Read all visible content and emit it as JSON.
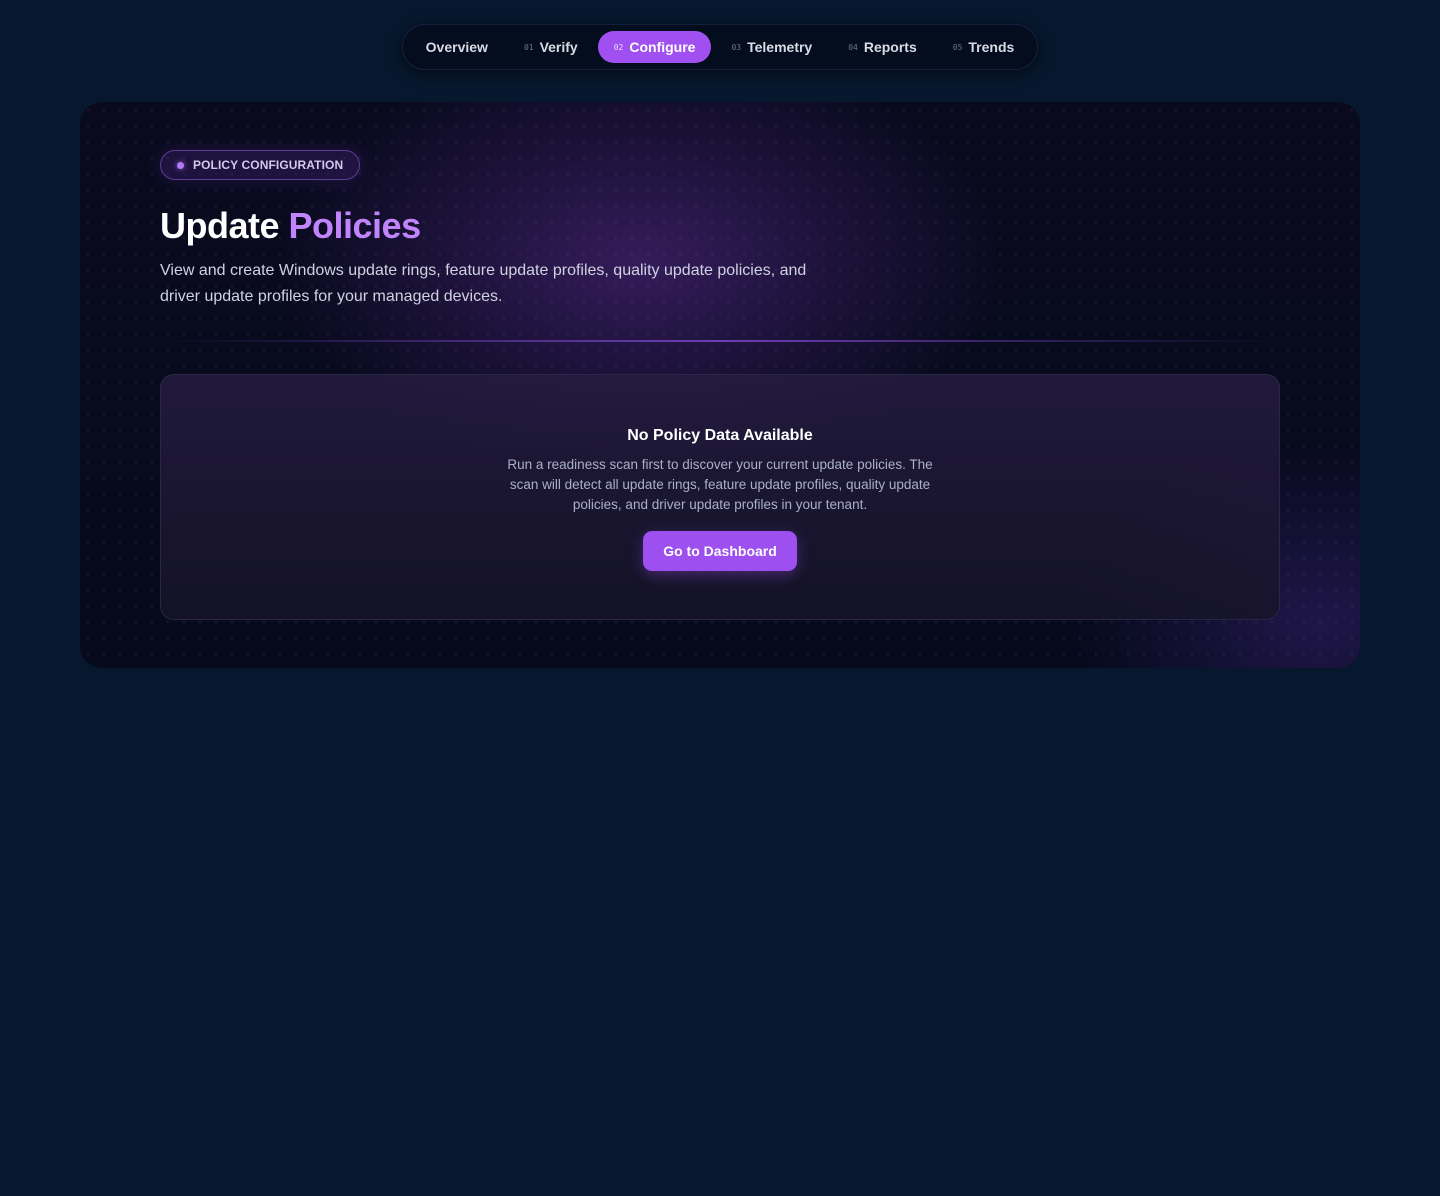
{
  "nav": {
    "items": [
      {
        "num": "",
        "label": "Overview",
        "active": false
      },
      {
        "num": "01",
        "label": "Verify",
        "active": false
      },
      {
        "num": "02",
        "label": "Configure",
        "active": true
      },
      {
        "num": "03",
        "label": "Telemetry",
        "active": false
      },
      {
        "num": "04",
        "label": "Reports",
        "active": false
      },
      {
        "num": "05",
        "label": "Trends",
        "active": false
      }
    ]
  },
  "hero": {
    "badge": "POLICY CONFIGURATION",
    "title_main": "Update",
    "title_accent": "Policies",
    "subtitle": "View and create Windows update rings, feature update profiles, quality update policies, and driver update profiles for your managed devices."
  },
  "empty_state": {
    "title": "No Policy Data Available",
    "text": "Run a readiness scan first to discover your current update policies. The scan will detect all update rings, feature update profiles, quality update policies, and driver update profiles in your tenant.",
    "button": "Go to Dashboard"
  },
  "colors": {
    "background": "#07172d",
    "accent": "#a050f0",
    "title_accent": "#c084fc"
  }
}
